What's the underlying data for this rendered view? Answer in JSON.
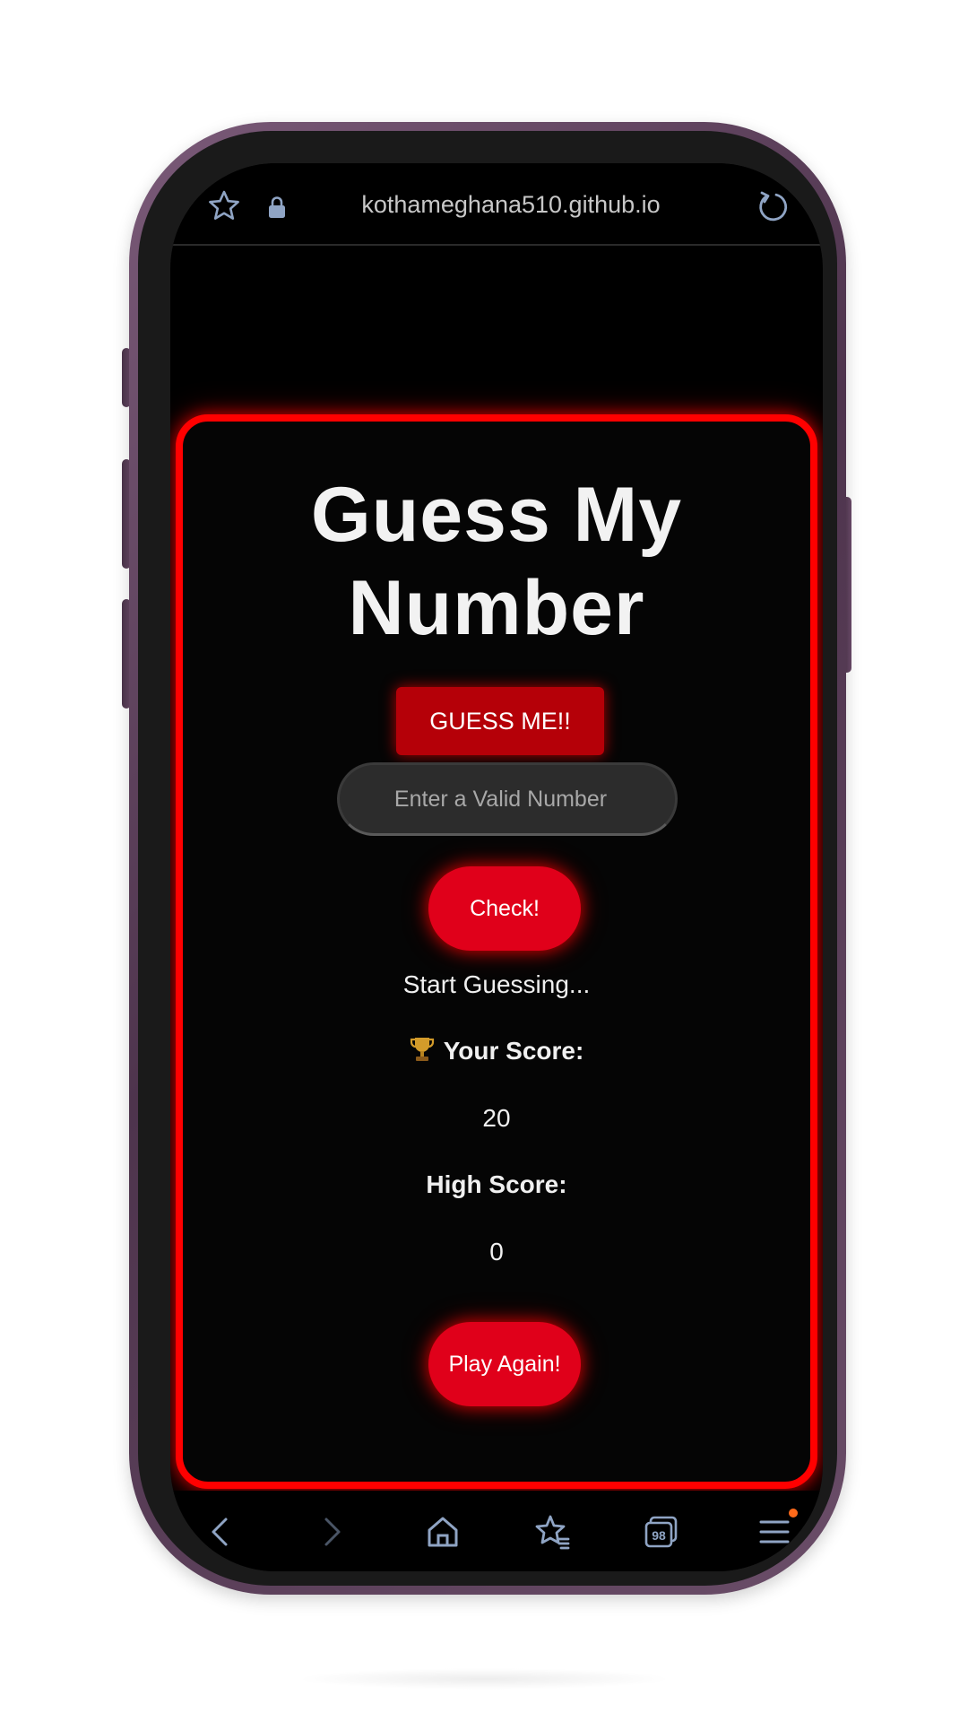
{
  "browser": {
    "url": "kothameghana510.github.io",
    "tabs_count": "98",
    "icons": [
      "star-icon",
      "lock-icon",
      "reload-icon",
      "back-icon",
      "forward-icon",
      "home-icon",
      "bookmarks-icon",
      "tabs-icon",
      "menu-icon"
    ]
  },
  "game": {
    "title": "Guess My Number",
    "hidden_number_label": "GUESS ME!!",
    "input_placeholder": "Enter a Valid Number",
    "input_value": "",
    "check_label": "Check!",
    "message": "Start Guessing...",
    "score_label": "Your Score:",
    "score_value": "20",
    "high_score_label": "High Score:",
    "high_score_value": "0",
    "play_again_label": "Play Again!"
  },
  "colors": {
    "accent_red": "#ff0000",
    "button_red": "#e0001a",
    "background": "#000000"
  }
}
